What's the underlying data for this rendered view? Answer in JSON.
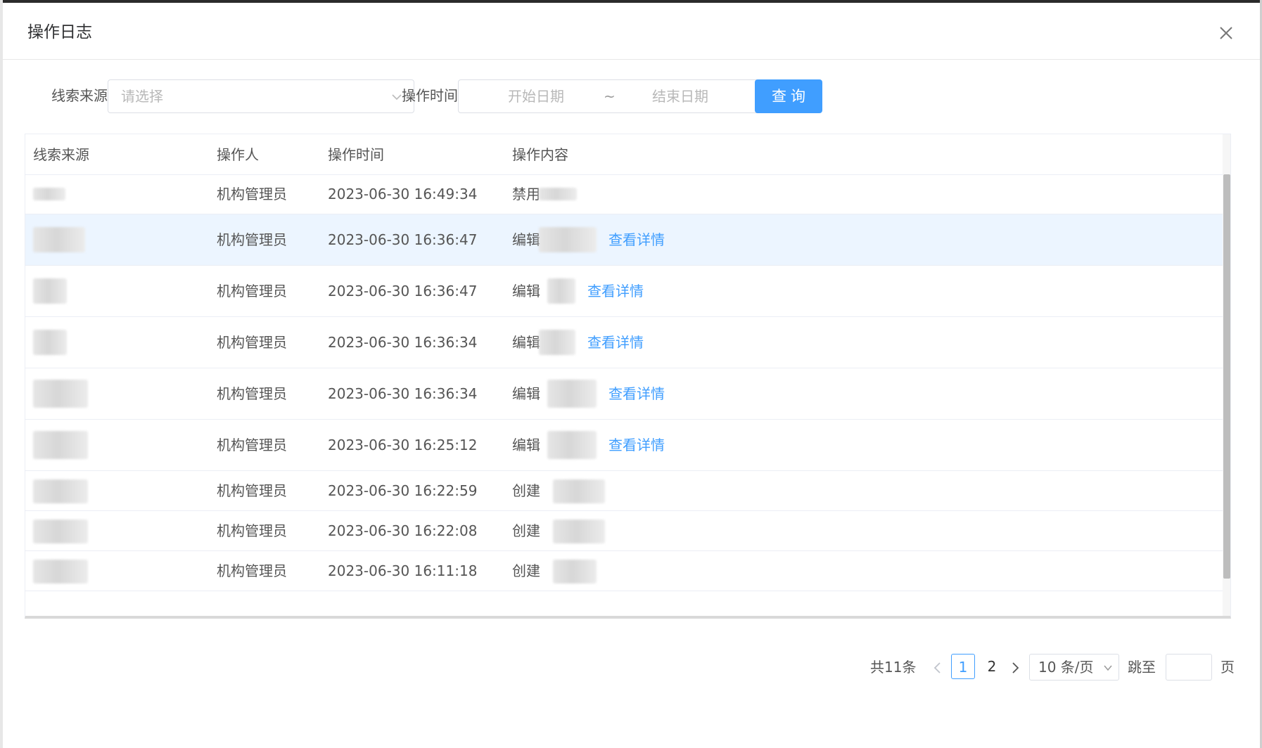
{
  "dialog": {
    "title": "操作日志"
  },
  "filters": {
    "source_label": "线索来源",
    "source_placeholder": "请选择",
    "time_label": "操作时间",
    "start_placeholder": "开始日期",
    "range_separator": "~",
    "end_placeholder": "结束日期",
    "query_button": "查询"
  },
  "table": {
    "columns": [
      "线索来源",
      "操作人",
      "操作时间",
      "操作内容"
    ],
    "rows": [
      {
        "operator": "机构管理员",
        "time": "2023-06-30 16:49:34",
        "action": "禁用",
        "detail_link": ""
      },
      {
        "operator": "机构管理员",
        "time": "2023-06-30 16:36:47",
        "action": "编辑",
        "detail_link": "查看详情"
      },
      {
        "operator": "机构管理员",
        "time": "2023-06-30 16:36:47",
        "action": "编辑",
        "detail_link": "查看详情"
      },
      {
        "operator": "机构管理员",
        "time": "2023-06-30 16:36:34",
        "action": "编辑",
        "detail_link": "查看详情"
      },
      {
        "operator": "机构管理员",
        "time": "2023-06-30 16:36:34",
        "action": "编辑",
        "detail_link": "查看详情"
      },
      {
        "operator": "机构管理员",
        "time": "2023-06-30 16:25:12",
        "action": "编辑",
        "detail_link": "查看详情"
      },
      {
        "operator": "机构管理员",
        "time": "2023-06-30 16:22:59",
        "action": "创建",
        "detail_link": ""
      },
      {
        "operator": "机构管理员",
        "time": "2023-06-30 16:22:08",
        "action": "创建",
        "detail_link": ""
      },
      {
        "operator": "机构管理员",
        "time": "2023-06-30 16:11:18",
        "action": "创建",
        "detail_link": ""
      }
    ]
  },
  "pagination": {
    "total": "共11条",
    "pages": [
      "1",
      "2"
    ],
    "current_page": "1",
    "page_size": "10 条/页",
    "jump_label": "跳至",
    "jump_value": "",
    "jump_suffix": "页"
  },
  "colors": {
    "accent": "#409eff",
    "row_hover": "#ecf5ff",
    "text": "#555555"
  }
}
